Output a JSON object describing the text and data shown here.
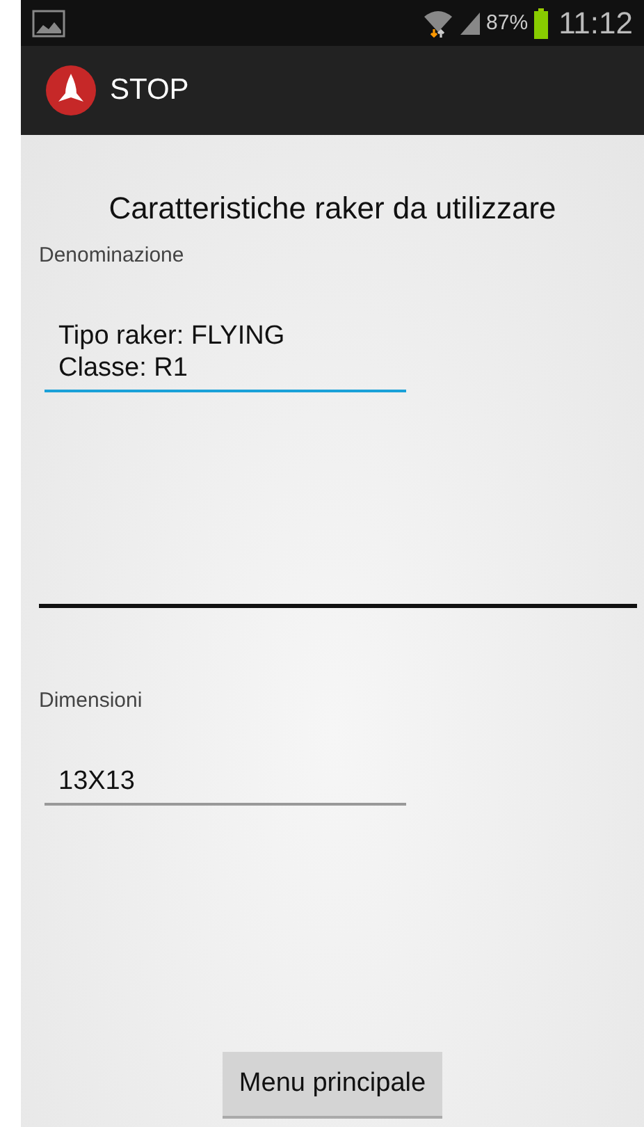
{
  "status_bar": {
    "battery": "87%",
    "time": "11:12"
  },
  "action_bar": {
    "title": "STOP"
  },
  "heading": "Caratteristiche raker da utilizzare",
  "fields": [
    {
      "label": "Denominazione",
      "value": "Tipo raker: FLYING\nClasse: R1",
      "focused": true
    },
    {
      "label": "Dimensioni",
      "value": "13X13",
      "focused": false
    }
  ],
  "button": "Menu principale"
}
